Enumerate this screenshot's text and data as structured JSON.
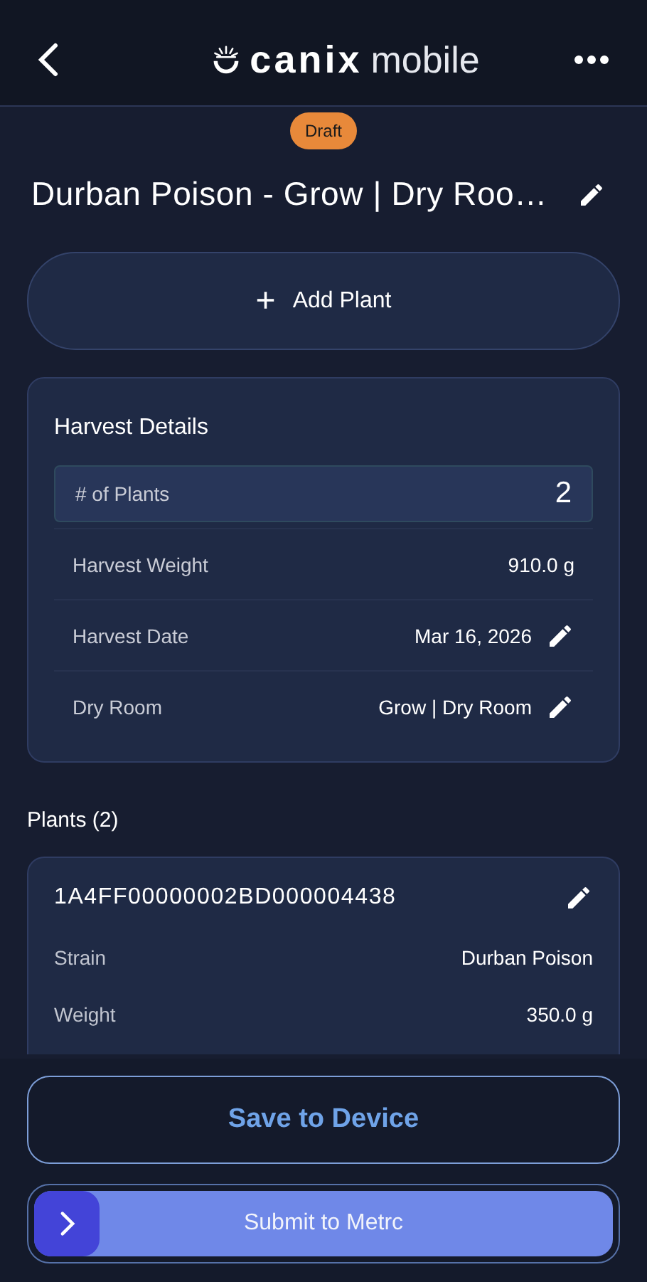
{
  "header": {
    "brand": "canix",
    "product": "mobile"
  },
  "status_badge": "Draft",
  "title": "Durban Poison - Grow | Dry Roo…",
  "add_button": {
    "icon": "+",
    "label": "Add Plant"
  },
  "harvest_details": {
    "heading": "Harvest Details",
    "rows": [
      {
        "kind": "field",
        "label": "# of Plants",
        "value": "2"
      },
      {
        "kind": "value",
        "label": "Harvest Weight",
        "value": "910.0 g"
      },
      {
        "kind": "editable",
        "label": "Harvest Date",
        "value": "Mar 16, 2026"
      },
      {
        "kind": "editable",
        "label": "Dry Room",
        "value": "Grow | Dry Room"
      }
    ]
  },
  "plants": {
    "heading": "Plants (2)",
    "items": [
      {
        "tag": "1A4FF00000002BD000004438",
        "fields": [
          {
            "label": "Strain",
            "value": "Durban Poison"
          },
          {
            "label": "Weight",
            "value": "350.0 g"
          }
        ]
      }
    ]
  },
  "save_button": "Save to Device",
  "submit_slider": {
    "label": "Submit to Metrc",
    "level": 0
  }
}
